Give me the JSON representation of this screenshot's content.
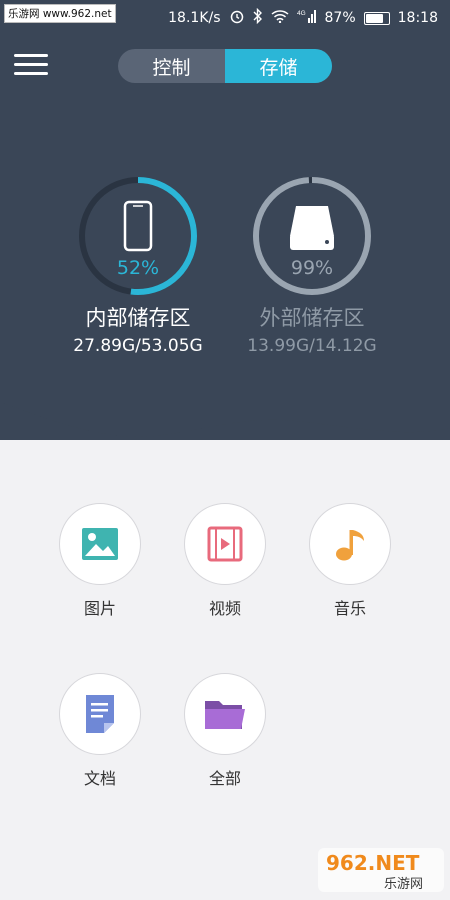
{
  "watermark": "乐游网 www.962.net",
  "statusbar": {
    "speed": "18.1K/s",
    "battery_pct_text": "87%",
    "battery_level": 0.87,
    "time": "18:18",
    "signal_label": "4G"
  },
  "tabs": {
    "control": "控制",
    "storage": "存储",
    "active": "storage"
  },
  "colors": {
    "header_bg": "#3a4657",
    "accent": "#2bb6d7",
    "external_ring": "#9aa5b1"
  },
  "internal": {
    "percent_text": "52%",
    "percent": 0.52,
    "name": "内部储存区",
    "size": "27.89G/53.05G"
  },
  "external": {
    "percent_text": "99%",
    "percent": 0.99,
    "name": "外部储存区",
    "size": "13.99G/14.12G"
  },
  "categories": [
    {
      "label": "图片",
      "icon": "image-icon"
    },
    {
      "label": "视频",
      "icon": "video-icon"
    },
    {
      "label": "音乐",
      "icon": "music-icon"
    },
    {
      "label": "文档",
      "icon": "document-icon"
    },
    {
      "label": "全部",
      "icon": "folder-icon"
    }
  ],
  "brand_logo": {
    "line1": "962.NET",
    "line2": "乐游网"
  }
}
